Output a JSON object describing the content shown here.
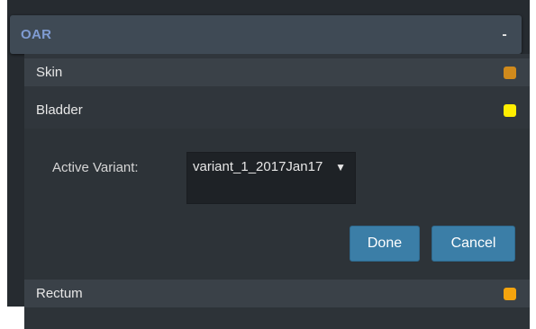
{
  "section": {
    "title": "OAR",
    "collapse_label": "-"
  },
  "structures": [
    {
      "label": "Skin",
      "color": "#d08a1c"
    },
    {
      "label": "Bladder",
      "color": "#ffee00"
    },
    {
      "label": "Rectum",
      "color": "#f5a40e"
    }
  ],
  "editor": {
    "active_variant_label": "Active Variant:",
    "active_variant_value": "variant_1_2017Jan17",
    "done_label": "Done",
    "cancel_label": "Cancel"
  }
}
